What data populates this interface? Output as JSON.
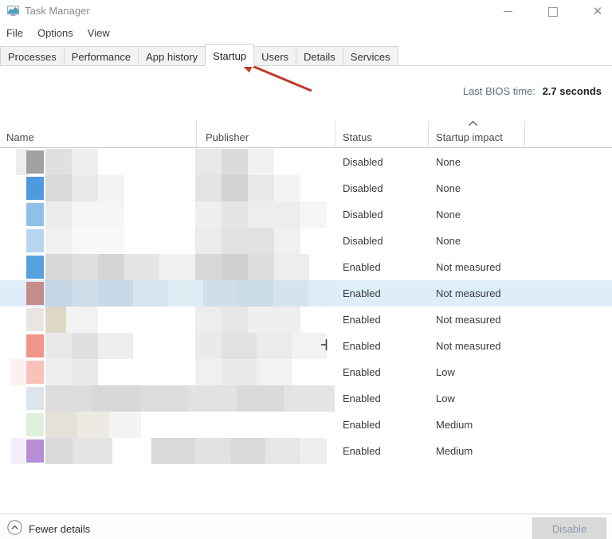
{
  "window": {
    "title": "Task Manager"
  },
  "menu": {
    "items": [
      "File",
      "Options",
      "View"
    ]
  },
  "tabs": {
    "items": [
      {
        "label": "Processes",
        "active": false
      },
      {
        "label": "Performance",
        "active": false
      },
      {
        "label": "App history",
        "active": false
      },
      {
        "label": "Startup",
        "active": true
      },
      {
        "label": "Users",
        "active": false
      },
      {
        "label": "Details",
        "active": false
      },
      {
        "label": "Services",
        "active": false
      }
    ]
  },
  "bios": {
    "label": "Last BIOS time:",
    "value": "2.7 seconds"
  },
  "table": {
    "columns": [
      "Name",
      "Publisher",
      "Status",
      "Startup impact"
    ],
    "sort_column": "Startup impact",
    "sort_direction": "ascending",
    "rows": [
      {
        "status": "Disabled",
        "impact": "None",
        "selected": false,
        "icon": "#a1a1a1",
        "blocks": [
          [
            20,
            17,
            "#ededed"
          ],
          [
            57,
            33,
            "#e0e0e0"
          ],
          [
            90,
            33,
            "#eeeeee"
          ],
          [
            245,
            33,
            "#e8e8e8"
          ],
          [
            278,
            33,
            "#dbdbdb"
          ],
          [
            311,
            33,
            "#f1f1f1"
          ]
        ]
      },
      {
        "status": "Disabled",
        "impact": "None",
        "selected": false,
        "icon": "#4f9ade",
        "blocks": [
          [
            57,
            33,
            "#d9d9d9"
          ],
          [
            90,
            33,
            "#e9e9e9"
          ],
          [
            123,
            33,
            "#f4f4f4"
          ],
          [
            245,
            33,
            "#e3e3e3"
          ],
          [
            278,
            33,
            "#d3d3d3"
          ],
          [
            311,
            33,
            "#e9e9e9"
          ],
          [
            344,
            33,
            "#f4f4f4"
          ]
        ]
      },
      {
        "status": "Disabled",
        "impact": "None",
        "selected": false,
        "icon": "#90c0e8",
        "blocks": [
          [
            57,
            33,
            "#ebebeb"
          ],
          [
            90,
            66,
            "#f5f5f5"
          ],
          [
            245,
            33,
            "#efefef"
          ],
          [
            278,
            33,
            "#e5e5e5"
          ],
          [
            311,
            66,
            "#ededed"
          ],
          [
            377,
            33,
            "#f6f6f6"
          ]
        ]
      },
      {
        "status": "Disabled",
        "impact": "None",
        "selected": false,
        "icon": "#b7d7f0",
        "blocks": [
          [
            57,
            33,
            "#f0f0f0"
          ],
          [
            90,
            66,
            "#f8f8f8"
          ],
          [
            245,
            33,
            "#ebebeb"
          ],
          [
            278,
            66,
            "#e1e1e1"
          ],
          [
            344,
            33,
            "#f0f0f0"
          ]
        ]
      },
      {
        "status": "Enabled",
        "impact": "Not measured",
        "selected": false,
        "icon": "#57a0dd",
        "blocks": [
          [
            57,
            33,
            "#d8d8d8"
          ],
          [
            90,
            33,
            "#dfdfdf"
          ],
          [
            123,
            33,
            "#d5d5d5"
          ],
          [
            156,
            44,
            "#e5e5e5"
          ],
          [
            200,
            45,
            "#f1f1f1"
          ],
          [
            245,
            33,
            "#d7d7d7"
          ],
          [
            278,
            33,
            "#d0d0d0"
          ],
          [
            311,
            33,
            "#dddddd"
          ],
          [
            344,
            44,
            "#ededed"
          ]
        ]
      },
      {
        "status": "Enabled",
        "impact": "Not measured",
        "selected": true,
        "icon": "#c48c8c",
        "blocks": [
          [
            57,
            33,
            "#c4d6e3"
          ],
          [
            90,
            33,
            "#cddde9"
          ],
          [
            123,
            44,
            "#c7d9e6"
          ],
          [
            167,
            44,
            "#d5e4ee"
          ],
          [
            211,
            44,
            "#e0ecf4"
          ],
          [
            255,
            44,
            "#cedfe9"
          ],
          [
            299,
            44,
            "#c9dce7"
          ],
          [
            343,
            44,
            "#d3e4ed"
          ],
          [
            387,
            33,
            "#ddebf4"
          ]
        ]
      },
      {
        "status": "Enabled",
        "impact": "Not measured",
        "selected": false,
        "icon": "#e9e6e2",
        "blocks": [
          [
            57,
            26,
            "#ddd7c5"
          ],
          [
            83,
            40,
            "#f2f2f2"
          ],
          [
            245,
            33,
            "#ededed"
          ],
          [
            278,
            33,
            "#e7e7e7"
          ],
          [
            311,
            66,
            "#efefef"
          ]
        ]
      },
      {
        "status": "Enabled",
        "impact": "Not measured",
        "selected": false,
        "icon": "#f2958a",
        "blocks": [
          [
            57,
            33,
            "#e9e9e9"
          ],
          [
            90,
            33,
            "#dfdfdf"
          ],
          [
            123,
            44,
            "#eeeeee"
          ],
          [
            245,
            33,
            "#eaeaea"
          ],
          [
            278,
            44,
            "#e2e2e2"
          ],
          [
            322,
            44,
            "#ebebeb"
          ],
          [
            366,
            44,
            "#f2f2f2"
          ]
        ]
      },
      {
        "status": "Enabled",
        "impact": "Low",
        "selected": false,
        "icon": "#f7c2b9",
        "blocks": [
          [
            14,
            18,
            "#fdf0ee"
          ],
          [
            57,
            33,
            "#efefef"
          ],
          [
            90,
            33,
            "#e9e9e9"
          ],
          [
            245,
            33,
            "#f0f0f0"
          ],
          [
            278,
            44,
            "#eaeaea"
          ],
          [
            322,
            44,
            "#f2f2f2"
          ]
        ]
      },
      {
        "status": "Enabled",
        "impact": "Low",
        "selected": false,
        "icon": "#dde4eb",
        "blocks": [
          [
            57,
            60,
            "#dcdcdc"
          ],
          [
            117,
            60,
            "#d8d8d8"
          ],
          [
            177,
            60,
            "#dddddd"
          ],
          [
            237,
            60,
            "#e2e2e2"
          ],
          [
            297,
            60,
            "#dadada"
          ],
          [
            357,
            63,
            "#e4e4e4"
          ]
        ]
      },
      {
        "status": "Enabled",
        "impact": "Medium",
        "selected": false,
        "icon": "#dff1da",
        "blocks": [
          [
            57,
            40,
            "#e4e2d8"
          ],
          [
            97,
            40,
            "#eceae2"
          ],
          [
            137,
            40,
            "#f4f4f4"
          ]
        ]
      },
      {
        "status": "Enabled",
        "impact": "Medium",
        "selected": false,
        "icon": "#b78ed6",
        "blocks": [
          [
            14,
            18,
            "#f5eefa"
          ],
          [
            57,
            34,
            "#d9d9d9"
          ],
          [
            91,
            50,
            "#e4e4e4"
          ],
          [
            190,
            60,
            "#d9d9d9"
          ],
          [
            250,
            60,
            "#e3e3e3"
          ],
          [
            310,
            50,
            "#ededed"
          ],
          [
            245,
            44,
            "#e2e2e2"
          ],
          [
            289,
            44,
            "#dadada"
          ],
          [
            333,
            44,
            "#e6e6e6"
          ],
          [
            377,
            33,
            "#efefef"
          ]
        ]
      }
    ]
  },
  "footer": {
    "toggle_label": "Fewer details",
    "disable_label": "Disable"
  },
  "colors": {
    "selection_highlight": "#ddeefa",
    "annotation_arrow": "#c13a2c",
    "disabled_button_bg": "#d9d9d9",
    "disabled_button_text": "#8c99ad"
  }
}
